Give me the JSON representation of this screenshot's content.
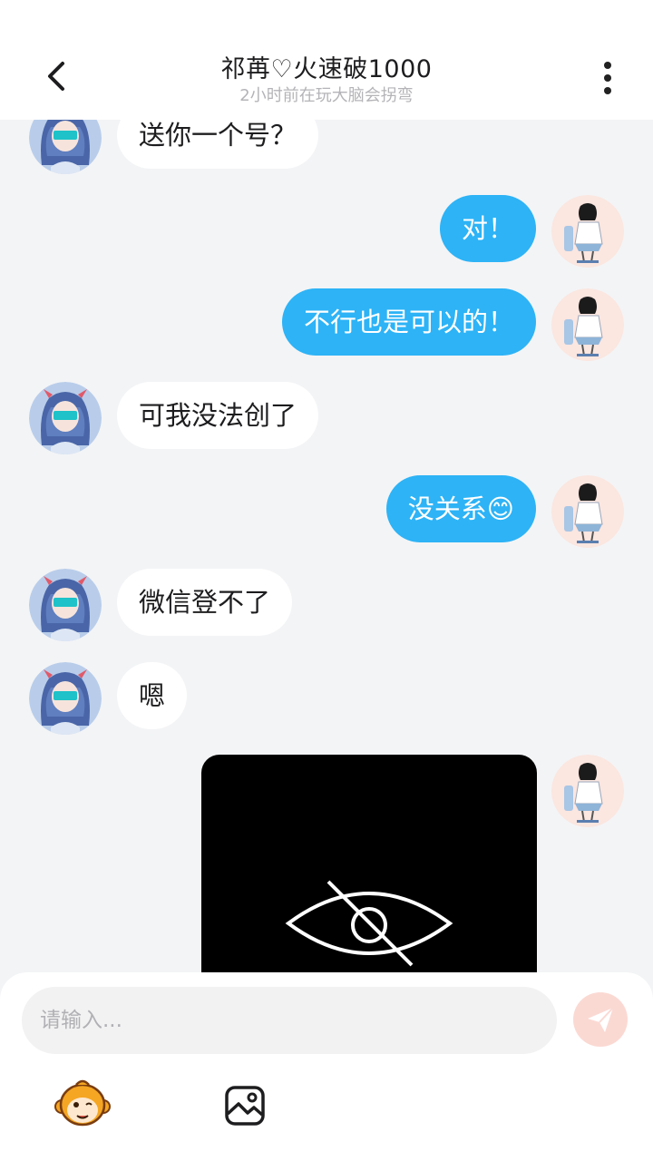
{
  "header": {
    "title": "祁苒♡火速破1000",
    "subtitle": "2小时前在玩大脑会拐弯"
  },
  "messages": [
    {
      "side": "left",
      "text": "送你一个号？"
    },
    {
      "side": "right",
      "text": "对！"
    },
    {
      "side": "right",
      "text": "不行也是可以的！"
    },
    {
      "side": "left",
      "text": "可我没法创了"
    },
    {
      "side": "right",
      "text": "没关系😊"
    },
    {
      "side": "left",
      "text": "微信登不了"
    },
    {
      "side": "left",
      "text": "嗯"
    },
    {
      "side": "right",
      "type": "image",
      "content": "hidden-image"
    }
  ],
  "input": {
    "placeholder": "请输入..."
  },
  "colors": {
    "accent": "#2db3f6",
    "send_button": "#fbd9d3"
  },
  "icons": {
    "back": "chevron-left-icon",
    "more": "more-vertical-icon",
    "hidden": "eye-off-icon",
    "send": "send-icon",
    "emoji": "monkey-emoji-icon",
    "image": "image-icon"
  }
}
